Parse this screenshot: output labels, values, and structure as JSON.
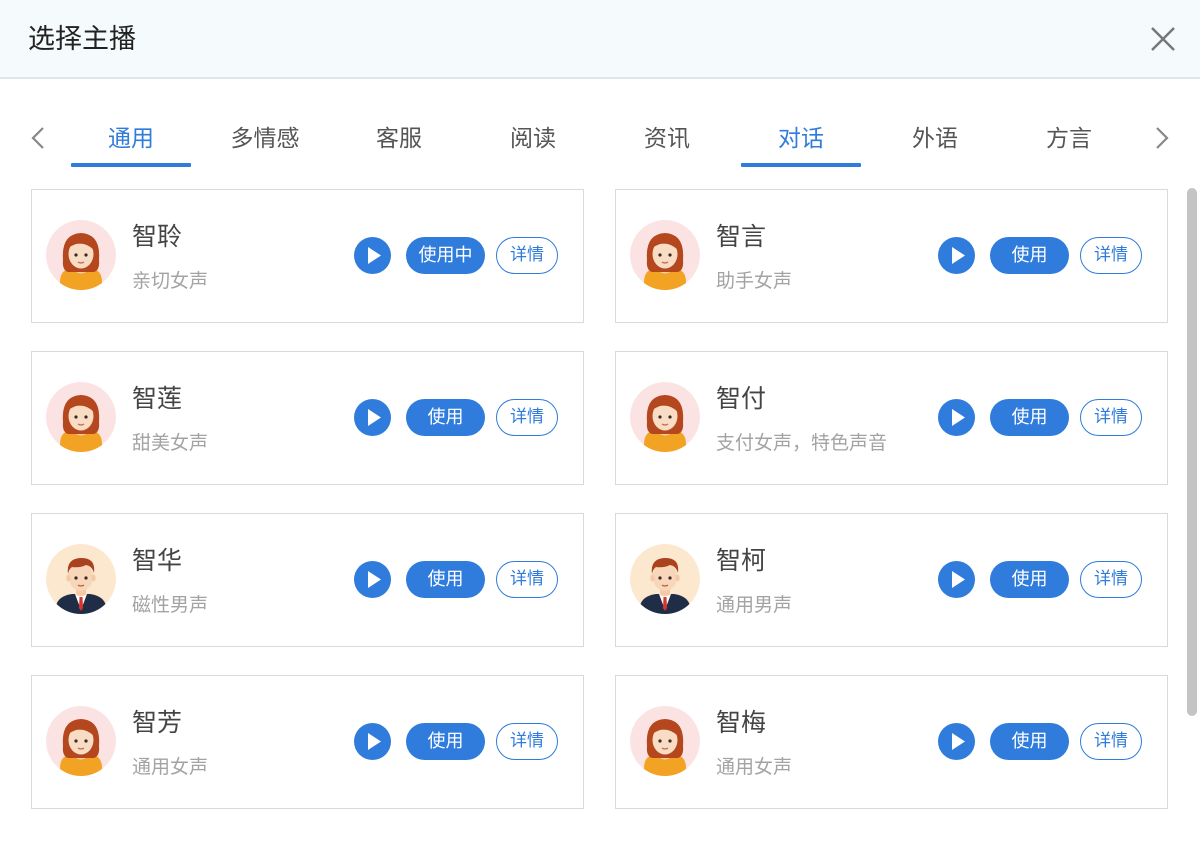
{
  "dialog": {
    "title": "选择主播",
    "close_icon": "close-icon"
  },
  "tabs": [
    {
      "label": "通用",
      "active": true
    },
    {
      "label": "多情感",
      "active": false
    },
    {
      "label": "客服",
      "active": false
    },
    {
      "label": "阅读",
      "active": false
    },
    {
      "label": "资讯",
      "active": false
    },
    {
      "label": "对话",
      "active": true
    },
    {
      "label": "外语",
      "active": false
    },
    {
      "label": "方言",
      "active": false
    }
  ],
  "tab_arrows": {
    "left_icon": "chevron-left-icon",
    "right_icon": "chevron-right-icon"
  },
  "anchors": [
    {
      "name": "智聆",
      "desc": "亲切女声",
      "gender": "female",
      "use_label": "使用中",
      "detail_label": "详情"
    },
    {
      "name": "智言",
      "desc": "助手女声",
      "gender": "female",
      "use_label": "使用",
      "detail_label": "详情"
    },
    {
      "name": "智莲",
      "desc": "甜美女声",
      "gender": "female",
      "use_label": "使用",
      "detail_label": "详情"
    },
    {
      "name": "智付",
      "desc": "支付女声，特色声音",
      "gender": "female",
      "use_label": "使用",
      "detail_label": "详情"
    },
    {
      "name": "智华",
      "desc": "磁性男声",
      "gender": "male",
      "use_label": "使用",
      "detail_label": "详情"
    },
    {
      "name": "智柯",
      "desc": "通用男声",
      "gender": "male",
      "use_label": "使用",
      "detail_label": "详情"
    },
    {
      "name": "智芳",
      "desc": "通用女声",
      "gender": "female",
      "use_label": "使用",
      "detail_label": "详情"
    },
    {
      "name": "智梅",
      "desc": "通用女声",
      "gender": "female",
      "use_label": "使用",
      "detail_label": "详情"
    }
  ],
  "colors": {
    "accent": "#2f7cdc",
    "header_bg": "#f5fafd",
    "female_avatar_bg": "#fbe3e3",
    "male_avatar_bg": "#fce8cf"
  }
}
